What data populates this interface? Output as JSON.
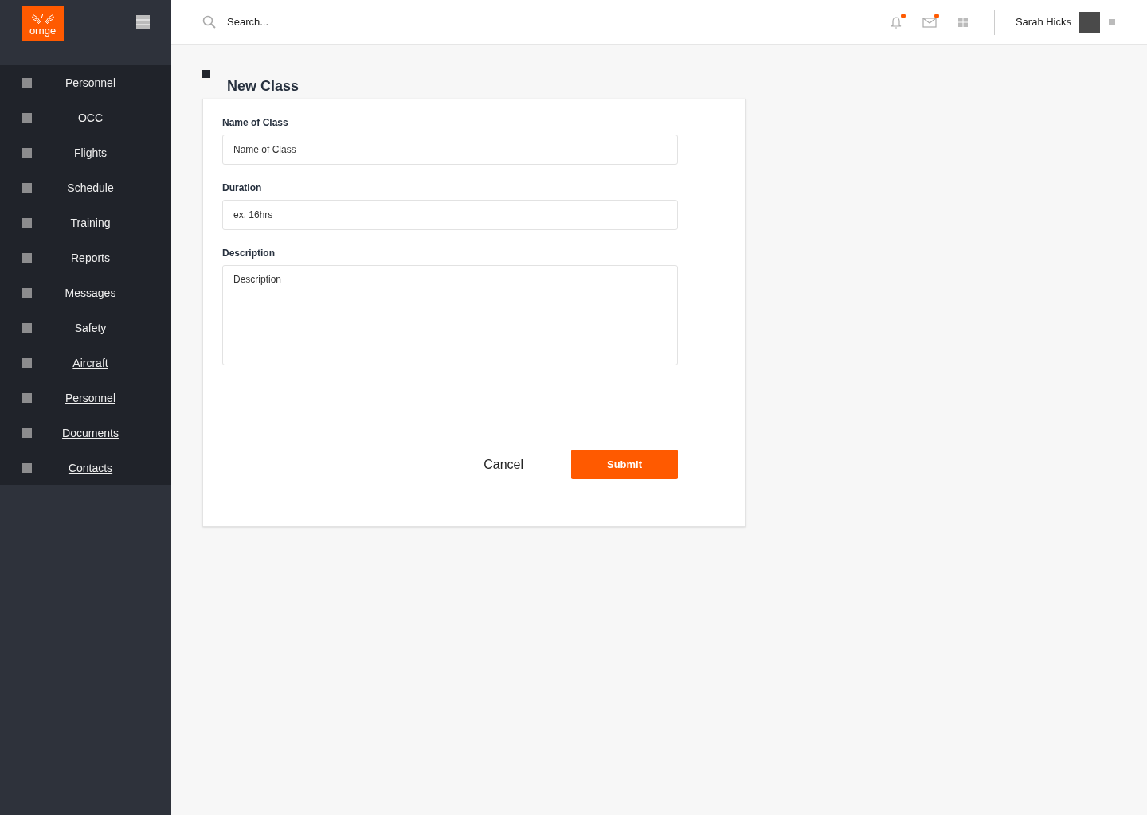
{
  "logo": {
    "text": "ornge"
  },
  "sidebar": {
    "items": [
      {
        "label": "Personnel"
      },
      {
        "label": "OCC"
      },
      {
        "label": "Flights"
      },
      {
        "label": "Schedule"
      },
      {
        "label": "Training"
      },
      {
        "label": "Reports"
      },
      {
        "label": "Messages"
      },
      {
        "label": "Safety"
      },
      {
        "label": "Aircraft"
      },
      {
        "label": "Personnel"
      },
      {
        "label": "Documents"
      },
      {
        "label": "Contacts"
      }
    ]
  },
  "topbar": {
    "search": {
      "placeholder": "Search..."
    },
    "icons": [
      {
        "kind": "bell",
        "unread": true
      },
      {
        "kind": "mail",
        "unread": true
      },
      {
        "kind": "grid",
        "unread": false
      }
    ],
    "user": {
      "name": "Sarah Hicks"
    }
  },
  "page": {
    "title": "New Class"
  },
  "form": {
    "fields": [
      {
        "kind": "input",
        "label": "Name of Class",
        "placeholder": "Name of Class"
      },
      {
        "kind": "input",
        "label": "Duration",
        "placeholder": "ex. 16hrs"
      },
      {
        "kind": "textarea",
        "label": "Description",
        "placeholder": "Description"
      }
    ],
    "cancel": "Cancel",
    "submit": "Submit"
  }
}
